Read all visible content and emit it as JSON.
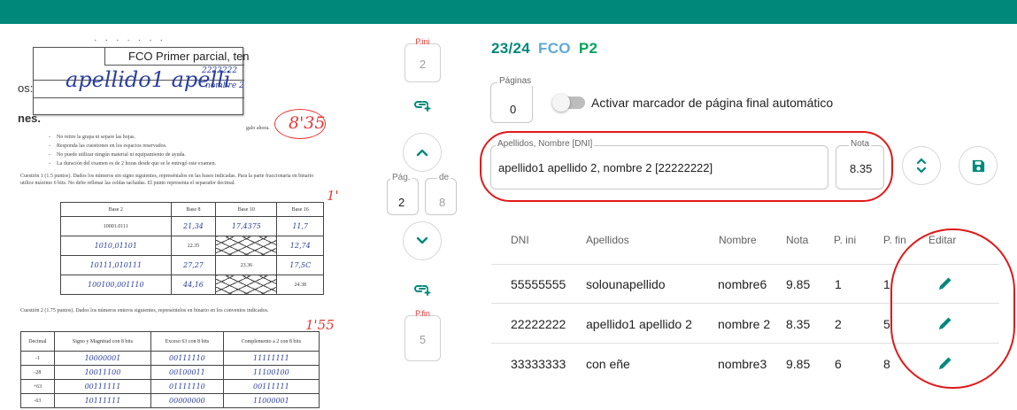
{
  "colors": {
    "brand": "#00897b",
    "subject": "#5fa9d8",
    "part": "#00a65a",
    "annotation": "#e01919"
  },
  "header": {
    "counter": "23/24",
    "subject": "FCO",
    "part": "P2"
  },
  "nav": {
    "pini_label": "P.ini",
    "pini_value": "2",
    "pfin_label": "P.fin",
    "pfin_value": "5",
    "pag_label": "Pág.",
    "pag_value": "2",
    "de_label": "de",
    "de_value": "8",
    "icons": {
      "link_top": "link-add-icon",
      "up": "chevron-up-icon",
      "down": "chevron-down-icon",
      "link_bottom": "link-add-icon"
    }
  },
  "paginas": {
    "label": "Páginas",
    "value": "0"
  },
  "toggle": {
    "label": "Activar marcador de página final automático",
    "on": false
  },
  "student": {
    "label": "Apellidos, Nombre [DNI]",
    "value": "apellido1 apellido 2, nombre 2 [22222222]"
  },
  "grade": {
    "label": "Nota",
    "value": "8.35"
  },
  "actions": {
    "swap_icon": "unfold-icon",
    "save_icon": "save-icon"
  },
  "table": {
    "headers": [
      "DNI",
      "Apellidos",
      "Nombre",
      "Nota",
      "P. ini",
      "P. fin",
      "Editar"
    ],
    "rows": [
      {
        "dni": "55555555",
        "apellidos": "solounapellido",
        "nombre": "nombre6",
        "nota": "9.85",
        "pini": "1",
        "pfin": "1"
      },
      {
        "dni": "22222222",
        "apellidos": "apellido1 apellido 2",
        "nombre": "nombre 2",
        "nota": "8.35",
        "pini": "2",
        "pfin": "5"
      },
      {
        "dni": "33333333",
        "apellidos": "con eñe",
        "nombre": "nombre3",
        "nota": "9.85",
        "pini": "6",
        "pfin": "8"
      }
    ],
    "edit_icon": "pencil-icon"
  },
  "scan": {
    "exam_title": "FCO Primer parcial, ten",
    "surnames_prefix": "os:",
    "surnames_hand": "apellido1 apelli",
    "dni_hand": "2222222",
    "name_hand": "nombre 2",
    "section_start": "nes.",
    "instruction_tail": "galo ahora.",
    "score_mark": "8'35",
    "instructions": [
      "No retire la grapa ni separe las hojas.",
      "Responda las cuestiones en los espacios reservados.",
      "No puede utilizar ningún material ni equipamiento de ayuda.",
      "La duración del examen es de 2 horas desde que se le entregó este examen."
    ],
    "q1_text": "Cuestión 1 (1.5 puntos). Dados los números sin signo siguientes, represéntalos en las bases indicadas. Para la parte fraccionaria en binario utilice máximo 6 bits. No debe rellenar las celdas tachadas. El punto representa el separador decimal.",
    "q1_mark": "1'5",
    "q1_headers": [
      "Base 2",
      "Base 8",
      "Base 10",
      "Base 16"
    ],
    "q1_rows": [
      [
        "10001.0111",
        "21,34",
        "17,4375",
        "11,7"
      ],
      [
        "1010,01101",
        "22.35",
        "",
        "12,74"
      ],
      [
        "10111,010111",
        "27,27",
        "23.36",
        "17,5C"
      ],
      [
        "100100,001110",
        "44,16",
        "",
        "24.38"
      ]
    ],
    "q2_text": "Cuestión 2 (1.75 puntos). Dados los números enteros siguientes, represéntelos en binario en los convenios indicados.",
    "q2_mark": "1'55",
    "q2_headers": [
      "Decimal",
      "Signo y Magnitud con 8 bits",
      "Exceso 63 con 8 bits",
      "Complemento a 2 con 8 bits"
    ],
    "q2_rows": [
      [
        "-1",
        "10000001",
        "00111110",
        "11111111"
      ],
      [
        "-28",
        "10011100",
        "00100011",
        "11100100"
      ],
      [
        "+63",
        "00111111",
        "01111110",
        "00111111"
      ],
      [
        "-63",
        "10111111",
        "00000000",
        "11000001"
      ]
    ]
  }
}
